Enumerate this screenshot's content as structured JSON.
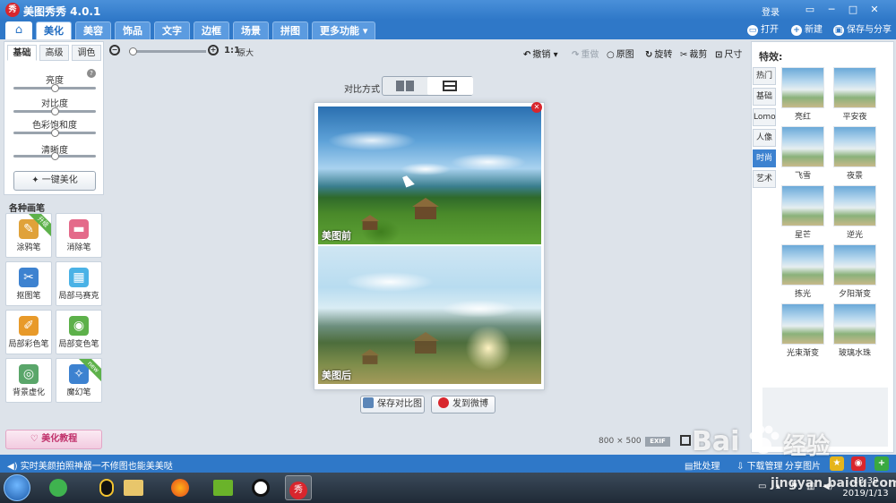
{
  "app": {
    "title": "美图秀秀 4.0.1",
    "logo_text": "秀"
  },
  "titlebar": {
    "login": "登录",
    "window_buttons": [
      "▭",
      "─",
      "□",
      "✕"
    ]
  },
  "menu": {
    "home_icon": "home-icon",
    "tabs": [
      "美化",
      "美容",
      "饰品",
      "文字",
      "边框",
      "场景",
      "拼图",
      "更多功能 ▾"
    ],
    "active_tab": "美化",
    "right_actions": [
      {
        "label": "打开",
        "icon": "open-folder-icon"
      },
      {
        "label": "新建",
        "icon": "plus-icon"
      },
      {
        "label": "保存与分享",
        "icon": "save-icon"
      }
    ]
  },
  "adjust": {
    "subtabs": [
      "基础",
      "高级",
      "调色"
    ],
    "active_subtab": "基础",
    "sliders": [
      {
        "label": "亮度",
        "value": 0.5
      },
      {
        "label": "对比度",
        "value": 0.5
      },
      {
        "label": "色彩饱和度",
        "value": 0.5
      },
      {
        "label": "清晰度",
        "value": 0.5
      }
    ],
    "one_click": "一键美化"
  },
  "brushes": {
    "title": "各种画笔",
    "items": [
      {
        "label": "涂鸦笔",
        "badge": "升级",
        "color": "#e0a23a"
      },
      {
        "label": "消除笔",
        "badge": "",
        "color": "#e46a8a"
      },
      {
        "label": "抠图笔",
        "badge": "",
        "color": "#3d82d0"
      },
      {
        "label": "局部马赛克",
        "badge": "",
        "color": "#4ab2e6"
      },
      {
        "label": "局部彩色笔",
        "badge": "",
        "color": "#e89a2a"
      },
      {
        "label": "局部变色笔",
        "badge": "",
        "color": "#5db14a"
      },
      {
        "label": "背景虚化",
        "badge": "",
        "color": "#5aa66a"
      },
      {
        "label": "魔幻笔",
        "badge": "new",
        "color": "#3d82d0"
      }
    ],
    "tutorial": "美化教程"
  },
  "canvas_toolbar": {
    "zoom_level": "1:1",
    "zoom_original": "原大",
    "zoom_fraction": 0.0,
    "undo": "撤销",
    "redo": "重做",
    "original": "原图",
    "rotate": "旋转",
    "crop": "裁剪",
    "size": "尺寸"
  },
  "compare": {
    "label": "对比方式",
    "options": [
      "side-by-side",
      "top-bottom"
    ],
    "active": "top-bottom"
  },
  "photos": {
    "before": "美图前",
    "after": "美图后"
  },
  "actions": {
    "save_compare": "保存对比图",
    "post_weibo": "发到微博"
  },
  "image_info": {
    "width": "800",
    "times": "×",
    "height": "500",
    "exif": "EXIF"
  },
  "effects": {
    "title": "特效:",
    "categories": [
      "热门",
      "基础",
      "Lomo",
      "人像",
      "时尚",
      "艺术"
    ],
    "active_category": "时尚",
    "items": [
      "亮红",
      "平安夜",
      "飞雪",
      "夜景",
      "星芒",
      "逆光",
      "拣光",
      "夕阳渐变",
      "光束渐变",
      "玻璃水珠"
    ]
  },
  "statusbar": {
    "message": "实时美颜拍照神器一不修图也能美美哒",
    "links": [
      "批处理",
      "下载管理",
      "分享图片"
    ],
    "icons": [
      "star-icon",
      "weibo-icon",
      "add-icon"
    ]
  },
  "taskbar": {
    "apps": [
      "360",
      "QQ",
      "文件",
      "Firefox",
      "录屏",
      "录制",
      "美图秀秀"
    ],
    "active_app": "美图秀秀",
    "time": "18:39",
    "date": "2019/1/13"
  },
  "watermark": {
    "brand": "Bai",
    "brand2": "经验",
    "url": "jingyan.baidu.com"
  },
  "colors": {
    "primary": "#2f78c8",
    "accent": "#d8262d",
    "active_tab": "#3d82d0"
  }
}
